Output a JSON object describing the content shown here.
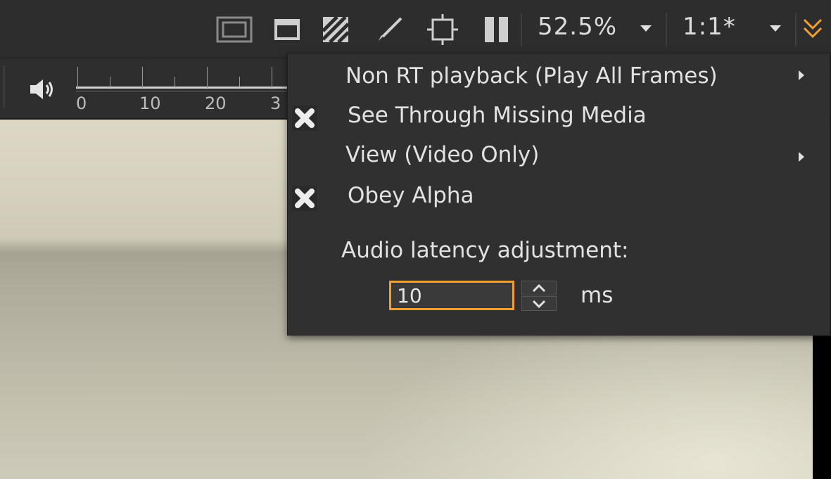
{
  "toolbar": {
    "icons": [
      "safe-area-icon",
      "square-icon",
      "hatch-icon",
      "brush-icon",
      "crop-icon",
      "pause-icon"
    ],
    "zoom_value": "52.5%",
    "ratio_value": "1:1*",
    "overflow_icon": "double-chevron-down-icon",
    "accent_color": "#f0a030"
  },
  "timeline": {
    "volume_icon": "speaker-icon",
    "tick_labels": [
      "0",
      "10",
      "20",
      "3"
    ]
  },
  "menu": {
    "items": [
      {
        "label": "Non RT playback (Play All Frames)",
        "has_submenu": true,
        "checked": false
      },
      {
        "label": "See Through Missing Media",
        "has_submenu": false,
        "checked": true
      },
      {
        "label": "View (Video Only)",
        "has_submenu": true,
        "checked": false
      },
      {
        "label": "Obey Alpha",
        "has_submenu": false,
        "checked": true
      }
    ],
    "audio_latency_label": "Audio latency adjustment:",
    "audio_latency_value": "10",
    "audio_latency_unit": "ms"
  }
}
